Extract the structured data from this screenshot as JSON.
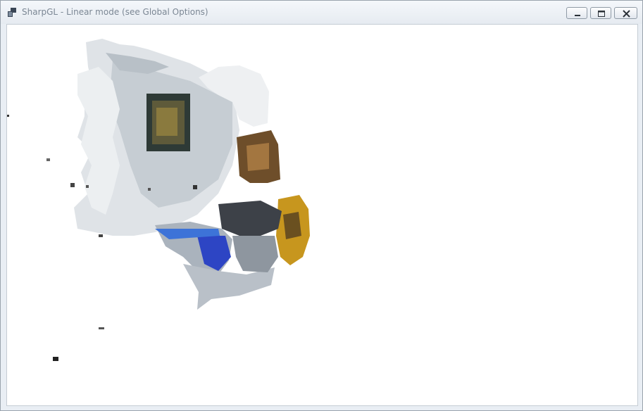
{
  "window": {
    "title": "SharpGL - Linear mode (see Global Options)",
    "icon": "app-icon",
    "buttons": {
      "minimize": "minimize-icon",
      "maximize": "maximize-icon",
      "close": "close-icon"
    }
  },
  "viewport": {
    "content": "3d-point-cloud-render",
    "background_color": "#ffffff"
  }
}
